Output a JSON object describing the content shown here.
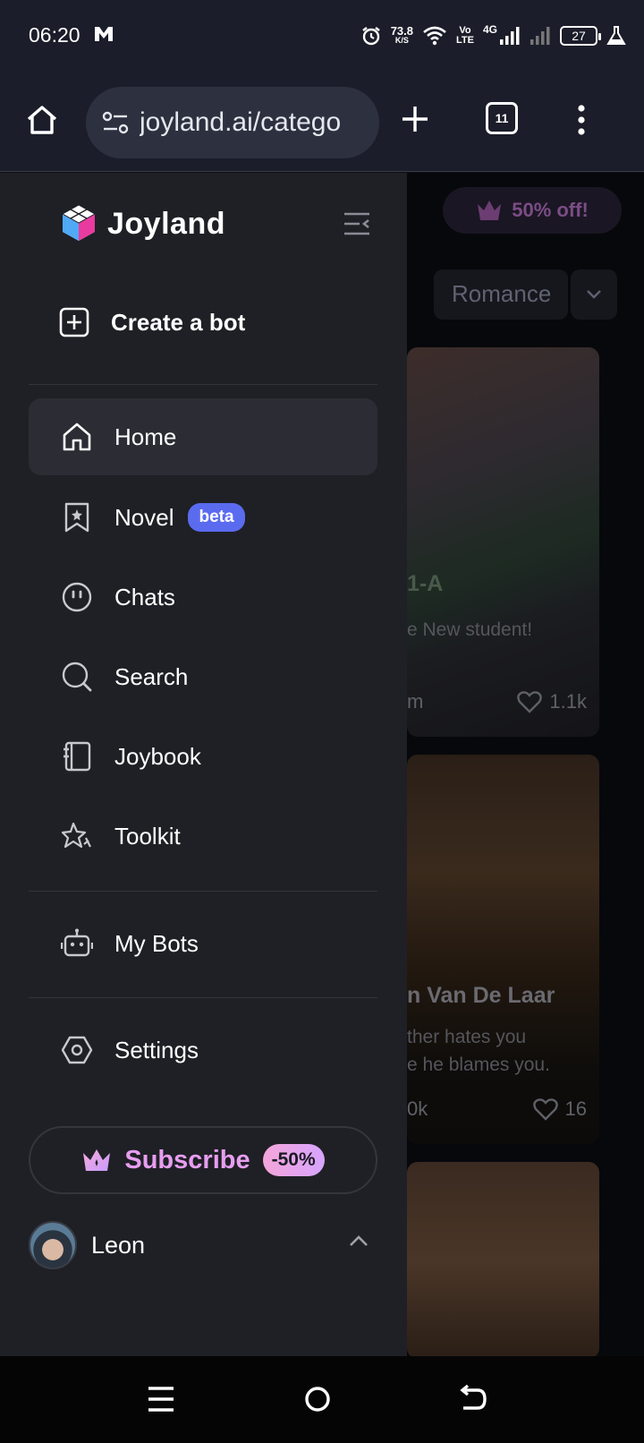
{
  "status_bar": {
    "time": "06:20",
    "speed_value": "73.8",
    "speed_unit": "K/S",
    "volte_top": "Vo",
    "volte_bottom": "LTE",
    "network": "4G",
    "battery": "27"
  },
  "browser": {
    "url": "joyland.ai/catego",
    "tab_count": "11"
  },
  "drawer": {
    "brand": "Joyland",
    "create_bot": "Create a bot",
    "nav": [
      {
        "label": "Home",
        "icon": "home-icon",
        "active": true
      },
      {
        "label": "Novel",
        "icon": "bookmark-star-icon",
        "badge": "beta"
      },
      {
        "label": "Chats",
        "icon": "chat-face-icon"
      },
      {
        "label": "Search",
        "icon": "search-icon"
      },
      {
        "label": "Joybook",
        "icon": "notebook-icon"
      },
      {
        "label": "Toolkit",
        "icon": "sparkle-star-icon"
      }
    ],
    "my_bots": "My Bots",
    "settings": "Settings",
    "subscribe": {
      "label": "Subscribe",
      "badge": "-50%"
    },
    "user": {
      "name": "Leon"
    }
  },
  "background": {
    "promo": "50% off!",
    "filter": "Romance",
    "cards": [
      {
        "title": "1-A",
        "desc": "e New student!",
        "meta": "m",
        "likes": "1.1k"
      },
      {
        "title": "n Van De Laar",
        "desc1": "ther hates you",
        "desc2": "e he blames you.",
        "meta": "0k",
        "likes": "16"
      },
      {
        "title": "",
        "likes": ""
      }
    ]
  },
  "colors": {
    "accent": "#5b6bf0",
    "subscribe_pink": "#e89ef0",
    "drawer_bg": "#1f2026",
    "active_bg": "#2c2d34"
  }
}
